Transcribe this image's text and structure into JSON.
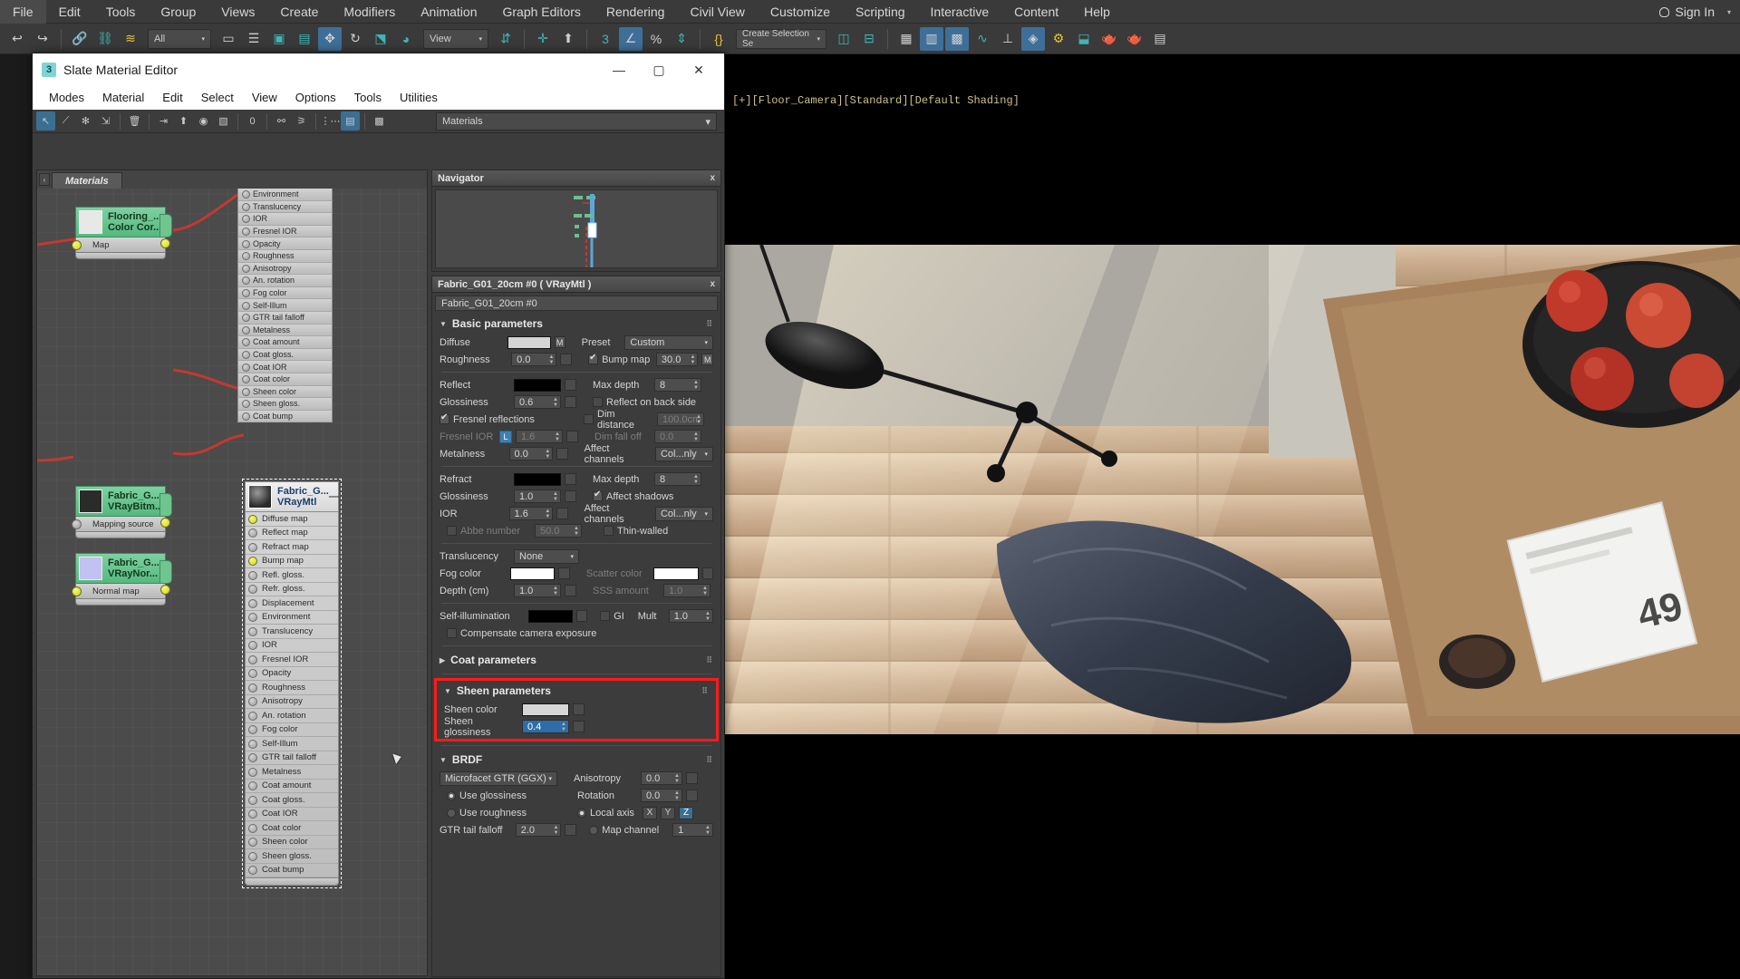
{
  "max_menu": [
    "File",
    "Edit",
    "Tools",
    "Group",
    "Views",
    "Create",
    "Modifiers",
    "Animation",
    "Graph Editors",
    "Rendering",
    "Civil View",
    "Customize",
    "Scripting",
    "Interactive",
    "Content",
    "Help"
  ],
  "sign_in": "Sign In",
  "max_toolbar": {
    "selection_filter": "All",
    "ref_coord": "View",
    "selection_set": "Create Selection Se"
  },
  "sme": {
    "title": "Slate Material Editor",
    "icon": "3",
    "minimize": "—",
    "maximize": "▢",
    "close": "✕",
    "menu": [
      "Modes",
      "Material",
      "Edit",
      "Select",
      "View",
      "Options",
      "Tools",
      "Utilities"
    ],
    "material_browser_combo": "Materials",
    "tab": "Materials"
  },
  "graph": {
    "nodes": [
      {
        "title1": "Flooring_...",
        "title2": "Color Cor...",
        "slots": [
          "Map"
        ]
      },
      {
        "title1": "Fabric_G...",
        "title2": "VRayBitm...",
        "slots": [
          "Mapping source"
        ]
      },
      {
        "title1": "Fabric_G...",
        "title2": "VRayNor...",
        "slots": [
          "Normal map"
        ]
      }
    ],
    "selected_node": {
      "title1": "Fabric_G...",
      "title2": "VRayMtl",
      "slots": [
        "Diffuse map",
        "Reflect map",
        "Refract map",
        "Bump map",
        "Refl. gloss.",
        "Refr. gloss.",
        "Displacement",
        "Environment",
        "Translucency",
        "IOR",
        "Fresnel IOR",
        "Opacity",
        "Roughness",
        "Anisotropy",
        "An. rotation",
        "Fog color",
        "Self-Illum",
        "GTR tail falloff",
        "Metalness",
        "Coat amount",
        "Coat gloss.",
        "Coat IOR",
        "Coat color",
        "Sheen color",
        "Sheen gloss.",
        "Coat bump"
      ]
    },
    "top_slot_list": [
      "Environment",
      "Translucency",
      "IOR",
      "Fresnel IOR",
      "Opacity",
      "Roughness",
      "Anisotropy",
      "An. rotation",
      "Fog color",
      "Self-Illum",
      "GTR tail falloff",
      "Metalness",
      "Coat amount",
      "Coat gloss.",
      "Coat IOR",
      "Coat color",
      "Sheen color",
      "Sheen gloss.",
      "Coat bump"
    ]
  },
  "navigator": {
    "title": "Navigator",
    "close": "x"
  },
  "params": {
    "header": "Fabric_G01_20cm #0  ( VRayMtl )",
    "close": "x",
    "name_value": "Fabric_G01_20cm #0",
    "basic": {
      "title": "Basic parameters",
      "diffuse_label": "Diffuse",
      "diffuse_color": "#d4d4d4",
      "diffuse_m": "M",
      "preset_label": "Preset",
      "preset_value": "Custom",
      "roughness_label": "Roughness",
      "roughness_value": "0.0",
      "bump_map_label": "Bump map",
      "bump_map_value": "30.0",
      "bump_m": "M",
      "reflect_label": "Reflect",
      "reflect_color": "#000000",
      "max_depth_label": "Max depth",
      "max_depth_value": "8",
      "glossiness_label": "Glossiness",
      "glossiness_value": "0.6",
      "reflect_back_label": "Reflect on back side",
      "fresnel_label": "Fresnel reflections",
      "dim_distance_label": "Dim distance",
      "dim_distance_value": "100.0cm",
      "fresnel_ior_label": "Fresnel IOR",
      "fresnel_ior_lock": "L",
      "fresnel_ior_value": "1.6",
      "dim_falloff_label": "Dim fall off",
      "dim_falloff_value": "0.0",
      "metalness_label": "Metalness",
      "metalness_value": "0.0",
      "affect_channels_label": "Affect channels",
      "affect_channels_value": "Col...nly",
      "refract_label": "Refract",
      "refract_color": "#000000",
      "max_depth2_label": "Max depth",
      "max_depth2_value": "8",
      "glossiness2_label": "Glossiness",
      "glossiness2_value": "1.0",
      "affect_shadows_label": "Affect shadows",
      "ior_label": "IOR",
      "ior_value": "1.6",
      "affect_channels2_label": "Affect channels",
      "affect_channels2_value": "Col...nly",
      "abbe_label": "Abbe number",
      "abbe_value": "50.0",
      "thin_walled_label": "Thin-walled",
      "translucency_label": "Translucency",
      "translucency_value": "None",
      "fog_color_label": "Fog color",
      "fog_color": "#ffffff",
      "scatter_color_label": "Scatter color",
      "scatter_color": "#ffffff",
      "depth_label": "Depth (cm)",
      "depth_value": "1.0",
      "sss_amount_label": "SSS amount",
      "sss_amount_value": "1.0",
      "self_illum_label": "Self-illumination",
      "self_illum_color": "#000000",
      "gi_label": "GI",
      "mult_label": "Mult",
      "mult_value": "1.0",
      "compensate_label": "Compensate camera exposure"
    },
    "coat": {
      "title": "Coat parameters"
    },
    "sheen": {
      "title": "Sheen parameters",
      "color_label": "Sheen color",
      "color": "#d6d6d6",
      "glossiness_label": "Sheen glossiness",
      "glossiness_value": "0.4"
    },
    "brdf": {
      "title": "BRDF",
      "model": "Microfacet GTR (GGX)",
      "use_glossiness": "Use glossiness",
      "use_roughness": "Use roughness",
      "gtr_tail_label": "GTR tail falloff",
      "gtr_tail_value": "2.0",
      "anisotropy_label": "Anisotropy",
      "anisotropy_value": "0.0",
      "rotation_label": "Rotation",
      "rotation_value": "0.0",
      "local_axis_label": "Local axis",
      "axis_x": "X",
      "axis_y": "Y",
      "axis_z": "Z",
      "map_channel_label": "Map channel",
      "map_channel_value": "1"
    }
  },
  "viewport": {
    "label": "[+][Floor_Camera][Standard][Default Shading]"
  },
  "colors": {
    "accent_blue": "#3e6f99",
    "highlight_red": "#ff1a1a",
    "node_green": "#55b97f"
  }
}
